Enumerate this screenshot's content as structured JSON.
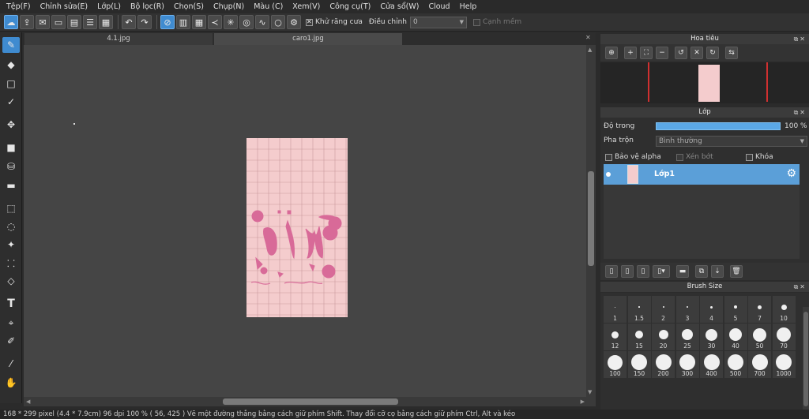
{
  "menu": [
    "Tệp(F)",
    "Chỉnh sửa(E)",
    "Lớp(L)",
    "Bộ lọc(R)",
    "Chọn(S)",
    "Chụp(N)",
    "Màu (C)",
    "Xem(V)",
    "Công cụ(T)",
    "Cửa sổ(W)",
    "Cloud",
    "Help"
  ],
  "toolbar": {
    "antialias_label": "Khử răng cưa",
    "adjust_label": "Điều chỉnh",
    "adjust_value": "0",
    "soft_edge_label": "Cạnh mềm"
  },
  "tabs": [
    {
      "label": "4.1.jpg"
    },
    {
      "label": "caro1.jpg"
    }
  ],
  "status": "168 * 299 pixel   (4.4 * 7.9cm)   96 dpi   100 %   ( 56, 425 )   Vẽ một đường thẳng bằng cách giữ phím Shift. Thay đổi cỡ cọ bằng cách giữ phím Ctrl, Alt và kéo",
  "navigator": {
    "title": "Hoa tiêu"
  },
  "layers": {
    "title": "Lớp",
    "opacity_label": "Độ trong",
    "opacity_value": "100 %",
    "opacity_fraction": 1.0,
    "blend_label": "Pha trộn",
    "blend_value": "Bình thường",
    "protect_alpha": "Bảo vệ alpha",
    "clipping": "Xén bớt",
    "lock": "Khóa",
    "items": [
      {
        "name": "Lớp1"
      }
    ]
  },
  "brush_size": {
    "title": "Brush Size",
    "sizes": [
      "1",
      "1.5",
      "2",
      "3",
      "4",
      "5",
      "7",
      "10",
      "12",
      "15",
      "20",
      "25",
      "30",
      "40",
      "50",
      "70",
      "100",
      "150",
      "200",
      "300",
      "400",
      "500",
      "700",
      "1000"
    ]
  },
  "colors": {
    "accent": "#3f8bd0",
    "paper": "#f4cccd",
    "ink": "#d86a98"
  }
}
